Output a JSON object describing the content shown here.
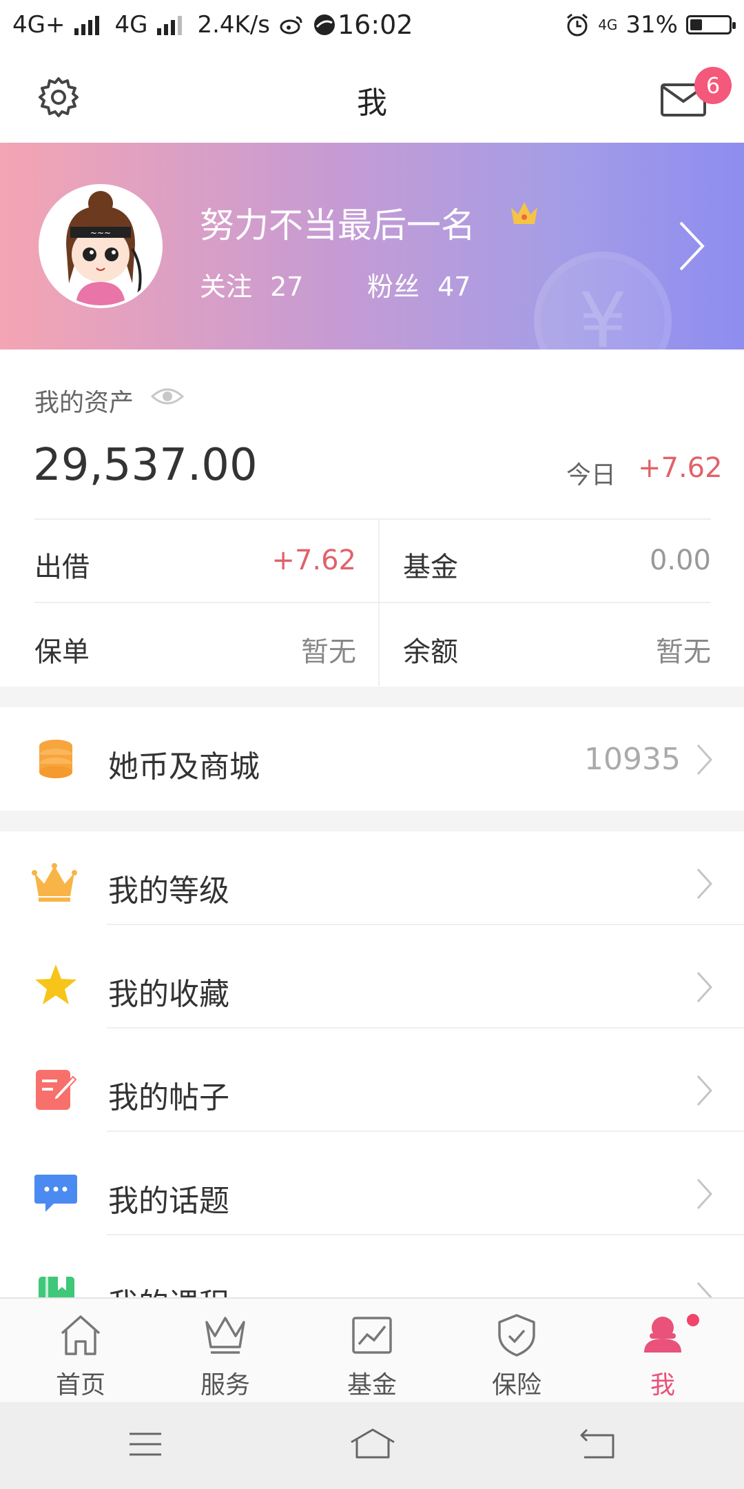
{
  "status_bar": {
    "network1": "4G+",
    "network2": "4G",
    "speed": "2.4K/s",
    "time": "16:02",
    "data_label": "4G",
    "battery": "31%",
    "battery_level": 0.31
  },
  "header": {
    "title": "我",
    "unread_count": "6",
    "settings_icon": "gear-icon",
    "mail_icon": "mail-icon"
  },
  "profile": {
    "nickname": "努力不当最后一名",
    "follow_label": "关注",
    "follow_count": "27",
    "fans_label": "粉丝",
    "fans_count": "47",
    "badge_icon": "crown-icon",
    "watermark": "¥"
  },
  "assets": {
    "label": "我的资产",
    "total": "29,537.00",
    "today_label": "今日",
    "today_value": "+7.62",
    "cells": [
      {
        "label": "出借",
        "value": "+7.62"
      },
      {
        "label": "基金",
        "value": "0.00"
      },
      {
        "label": "保单",
        "value": "暂无"
      },
      {
        "label": "余额",
        "value": "暂无"
      }
    ]
  },
  "coins": {
    "label": "她币及商城",
    "value": "10935",
    "icon": "coin-stack-icon"
  },
  "menu": [
    {
      "label": "我的等级",
      "icon": "crown-icon"
    },
    {
      "label": "我的收藏",
      "icon": "star-icon"
    },
    {
      "label": "我的帖子",
      "icon": "post-edit-icon"
    },
    {
      "label": "我的话题",
      "icon": "chat-bubble-icon"
    },
    {
      "label": "我的课程",
      "icon": "book-icon"
    }
  ],
  "tabs": [
    {
      "label": "首页",
      "icon": "home-icon"
    },
    {
      "label": "服务",
      "icon": "crown-outline-icon"
    },
    {
      "label": "基金",
      "icon": "chart-icon"
    },
    {
      "label": "保险",
      "icon": "shield-icon"
    },
    {
      "label": "我",
      "icon": "user-icon"
    }
  ],
  "colors": {
    "accent": "#e9527a",
    "positive": "#e0626a",
    "banner_start": "#f4a5b3",
    "banner_end": "#8e8df0"
  }
}
